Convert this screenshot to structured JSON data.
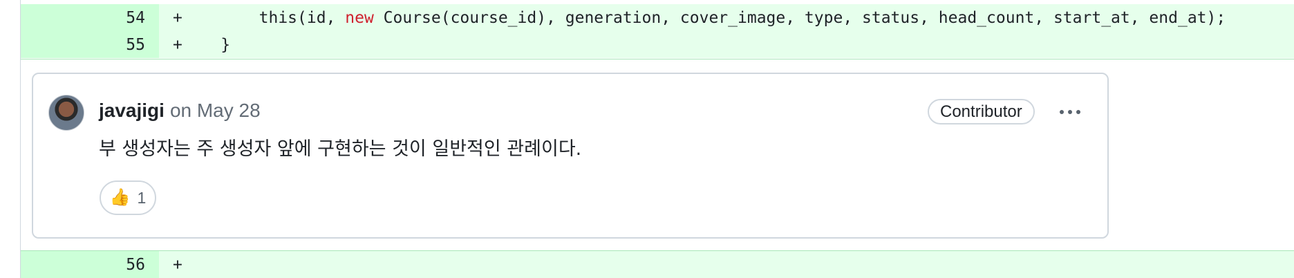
{
  "diff_top": [
    {
      "line": "54",
      "marker": "+",
      "code_pre": "        this(id, ",
      "code_kw": "new",
      "code_post": " Course(course_id), generation, cover_image, type, status, head_count, start_at, end_at);"
    },
    {
      "line": "55",
      "marker": "+",
      "code": "    }"
    }
  ],
  "comment": {
    "author": "javajigi",
    "date": "on May 28",
    "badge": "Contributor",
    "body": "부 생성자는 주 생성자 앞에 구현하는 것이 일반적인 관례이다.",
    "reaction": {
      "emoji": "👍",
      "count": "1"
    }
  },
  "diff_bottom": [
    {
      "line": "56",
      "marker": "+",
      "code": ""
    }
  ],
  "icons": {
    "avatar": "avatar-photo",
    "menu": "kebab-horizontal-icon",
    "reaction": "thumbs-up-emoji"
  },
  "colors": {
    "added_bg": "#e6ffec",
    "added_num_bg": "#ccffd8",
    "keyword": "#cf222e",
    "border": "#d0d7de"
  }
}
